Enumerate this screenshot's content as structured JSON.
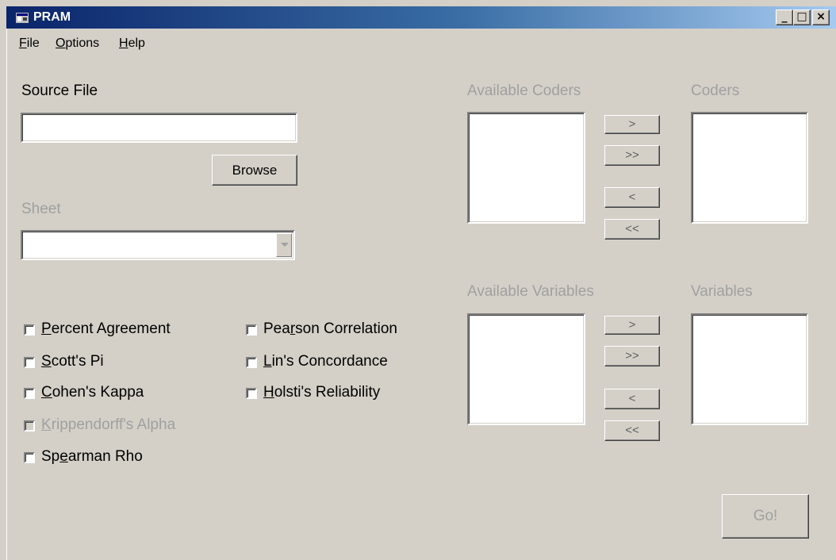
{
  "window": {
    "title": "PRAM",
    "controls": {
      "minimize": "_",
      "maximize": "□",
      "close": "×"
    }
  },
  "menu": [
    {
      "accel": "F",
      "rest": "ile"
    },
    {
      "accel": "O",
      "rest": "ptions"
    },
    {
      "accel": "H",
      "rest": "elp"
    }
  ],
  "source": {
    "label": "Source File",
    "value": "",
    "browse_label": "Browse"
  },
  "sheet": {
    "label": "Sheet",
    "value": ""
  },
  "coders": {
    "available_label": "Available Coders",
    "selected_label": "Coders",
    "add": ">",
    "add_all": ">>",
    "remove": "<",
    "remove_all": "<<"
  },
  "variables": {
    "available_label": "Available Variables",
    "selected_label": "Variables",
    "add": ">",
    "add_all": ">>",
    "remove": "<",
    "remove_all": "<<"
  },
  "options": [
    {
      "pre": "",
      "accel": "P",
      "post": "ercent Agreement",
      "checked": false,
      "enabled": true
    },
    {
      "pre": "",
      "accel": "S",
      "post": "cott's Pi",
      "checked": false,
      "enabled": true
    },
    {
      "pre": "",
      "accel": "C",
      "post": "ohen's Kappa",
      "checked": false,
      "enabled": true
    },
    {
      "pre": "",
      "accel": "K",
      "post": "rippendorff's Alpha",
      "checked": false,
      "enabled": false
    },
    {
      "pre": "Sp",
      "accel": "e",
      "post": "arman Rho",
      "checked": false,
      "enabled": true
    },
    {
      "pre": "Pea",
      "accel": "r",
      "post": "son Correlation",
      "checked": false,
      "enabled": true
    },
    {
      "pre": "",
      "accel": "L",
      "post": "in's Concordance",
      "checked": false,
      "enabled": true
    },
    {
      "pre": "",
      "accel": "H",
      "post": "olsti's Reliability",
      "checked": false,
      "enabled": true
    }
  ],
  "go_label": "Go!",
  "colors": {
    "face": "#d4d0c8",
    "title_start": "#0a246a",
    "title_end": "#a6caf0",
    "disabled_text": "#a0a0a0"
  }
}
